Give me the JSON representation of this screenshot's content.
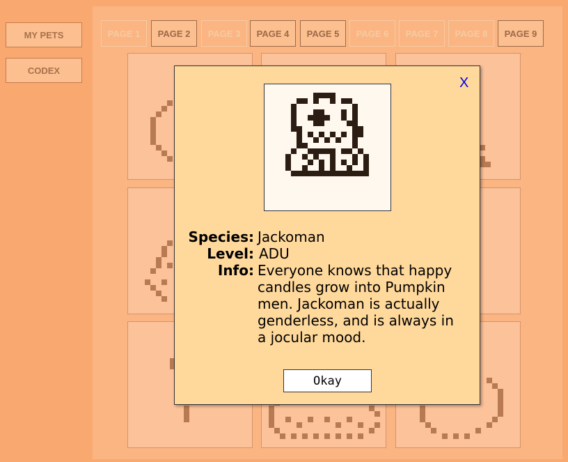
{
  "sidebar": {
    "my_pets_label": "MY PETS",
    "codex_label": "CODEX"
  },
  "tabs": [
    {
      "label": "PAGE 1",
      "state": "dim"
    },
    {
      "label": "PAGE 2",
      "state": "active"
    },
    {
      "label": "PAGE 3",
      "state": "dim"
    },
    {
      "label": "PAGE 4",
      "state": "active"
    },
    {
      "label": "PAGE 5",
      "state": "active"
    },
    {
      "label": "PAGE 6",
      "state": "dim"
    },
    {
      "label": "PAGE 7",
      "state": "dim"
    },
    {
      "label": "PAGE 8",
      "state": "dim"
    },
    {
      "label": "PAGE 9",
      "state": "active"
    }
  ],
  "modal": {
    "close_label": "X",
    "species_label": "Species:",
    "species_value": "Jackoman",
    "level_label": "Level:",
    "level_value": "ADU",
    "info_label": "Info:",
    "info_value": "Everyone knows that happy candles grow into Pumpkin men. Jackoman is actually genderless, and is always in a jocular mood.",
    "okay_label": "Okay"
  },
  "colors": {
    "background": "#f9a96f",
    "panel": "#fbb583",
    "card": "#fcc29a",
    "modal": "#ffd89b",
    "pixel_dark": "#2c1d12",
    "pixel_card": "#b87a52",
    "close_link": "#0000e6"
  }
}
